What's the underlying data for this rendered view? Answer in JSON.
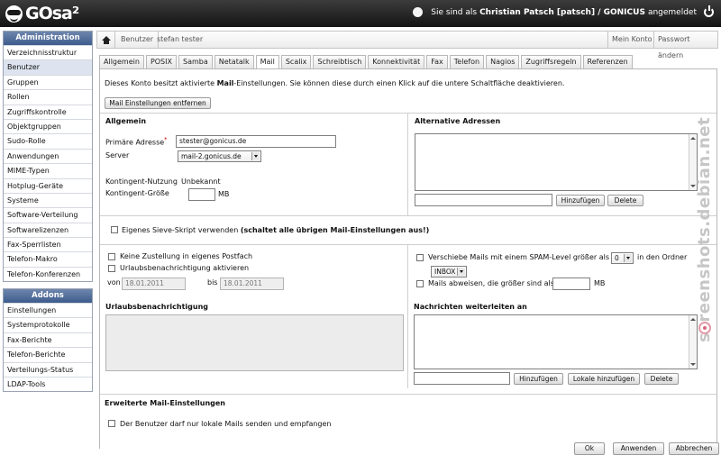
{
  "topbar": {
    "logo_text": "GOsa²",
    "user_prefix": "Sie sind als",
    "user_name": "Christian Patsch [patsch] / GONICUS",
    "user_suffix": "angemeldet"
  },
  "sidebar": {
    "admin_title": "Administration",
    "admin_items": [
      "Verzeichnisstruktur",
      "Benutzer",
      "Gruppen",
      "Rollen",
      "Zugriffskontrolle",
      "Objektgruppen",
      "Sudo-Rolle",
      "Anwendungen",
      "MIME-Typen",
      "Hotplug-Geräte",
      "Systeme",
      "Software-Verteilung",
      "Softwarelizenzen",
      "Fax-Sperrlisten",
      "Telefon-Makro",
      "Telefon-Konferenzen"
    ],
    "addons_title": "Addons",
    "addons_items": [
      "Einstellungen",
      "Systemprotokolle",
      "Fax-Berichte",
      "Telefon-Berichte",
      "Verteilungs-Status",
      "LDAP-Tools"
    ]
  },
  "header": {
    "breadcrumb_1": "Benutzer",
    "breadcrumb_2": "stefan tester",
    "my_account": "Mein Konto",
    "change_password": "Passwort ändern"
  },
  "tabs": [
    "Allgemein",
    "POSIX",
    "Samba",
    "Netatalk",
    "Mail",
    "Scalix",
    "Schreibtisch",
    "Konnektivität",
    "Fax",
    "Telefon",
    "Nagios",
    "Zugriffsregeln",
    "Referenzen"
  ],
  "mail": {
    "notice_pre": "Dieses Konto besitzt aktivierte",
    "notice_bold": "Mail",
    "notice_post": "-Einstellungen. Sie können diese durch einen Klick auf die untere Schaltfläche deaktivieren.",
    "remove_button": "Mail Einstellungen entfernen",
    "general": {
      "title": "Allgemein",
      "primary_label": "Primäre Adresse",
      "primary_value": "stester@gonicus.de",
      "server_label": "Server",
      "server_value": "mail-2.gonicus.de",
      "quota_usage_label": "Kontingent-Nutzung",
      "quota_usage_value": "Unbekannt",
      "quota_size_label": "Kontingent-Größe",
      "quota_unit": "MB"
    },
    "alternative": {
      "title": "Alternative Adressen",
      "add_button": "Hinzufügen",
      "delete_button": "Delete"
    },
    "sieve": {
      "label": "Eigenes Sieve-Skript verwenden",
      "bold": "(schaltet alle übrigen Mail-Einstellungen aus!)"
    },
    "options": {
      "no_delivery": "Keine Zustellung in eigenes Postfach",
      "vacation": "Urlaubsbenachrichtigung aktivieren",
      "from_label": "von",
      "from_value": "18.01.2011",
      "to_label": "bis",
      "to_value": "18.01.2011",
      "spam_pre": "Verschiebe Mails mit einem SPAM-Level größer als",
      "spam_level": "0",
      "spam_post": "in den Ordner",
      "spam_folder": "INBOX",
      "reject_label": "Mails abweisen, die größer sind als",
      "reject_unit": "MB"
    },
    "vacation_title": "Urlaubsbenachrichtigung",
    "forward": {
      "title": "Nachrichten weiterleiten an",
      "add_button": "Hinzufügen",
      "add_local_button": "Lokale hinzufügen",
      "delete_button": "Delete"
    },
    "advanced": {
      "title": "Erweiterte Mail-Einstellungen",
      "local_only": "Der Benutzer darf nur lokale Mails senden und empfangen"
    }
  },
  "footer": {
    "ok": "Ok",
    "apply": "Anwenden",
    "cancel": "Abbrechen"
  },
  "watermark": "screenshots.debian.net"
}
